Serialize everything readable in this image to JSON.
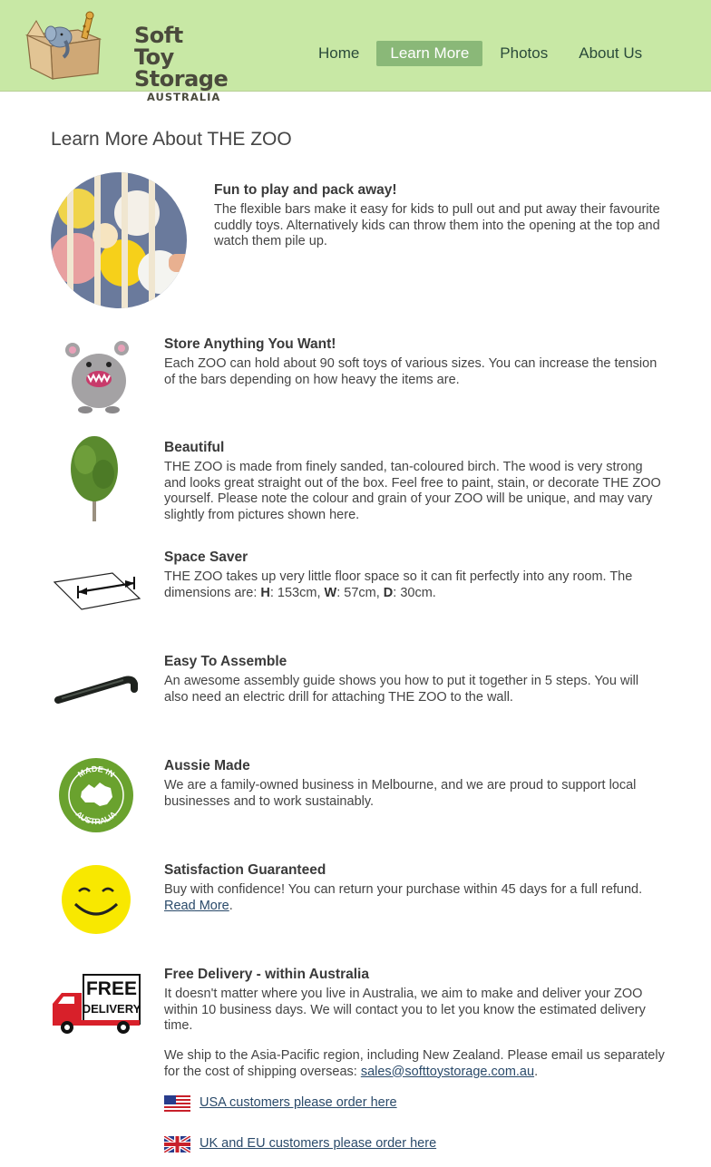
{
  "brand": {
    "line1": "Soft Toy",
    "line2": "Storage",
    "line3": "AUSTRALIA"
  },
  "nav": [
    {
      "label": "Home",
      "active": false
    },
    {
      "label": "Learn More",
      "active": true
    },
    {
      "label": "Photos",
      "active": false
    },
    {
      "label": "About Us",
      "active": false
    }
  ],
  "page": {
    "title": "Learn More About THE ZOO"
  },
  "features": [
    {
      "title": "Fun to play and pack away!",
      "body": "The flexible bars make it easy for kids to pull out and put away their favourite cuddly toys. Alternatively kids can throw them into the opening at the top and watch them pile up."
    },
    {
      "title": "Store Anything You Want!",
      "body": "Each ZOO can hold about 90 soft toys of various sizes. You can increase the tension of the bars depending on how heavy the items are."
    },
    {
      "title": "Beautiful",
      "body": "THE ZOO is made from finely sanded, tan-coloured birch. The wood is very strong and looks great straight out of the box. Feel free to paint, stain, or decorate THE ZOO yourself. Please note the colour and grain of your ZOO will be unique, and may vary slightly from pictures shown here."
    },
    {
      "title": "Space Saver",
      "body_prefix": "THE ZOO takes up very little floor space so it can fit perfectly into any room. The dimensions are: ",
      "h_label": "H",
      "h_value": ": 153cm, ",
      "w_label": "W",
      "w_value": ": 57cm, ",
      "d_label": "D",
      "d_value": ": 30cm."
    },
    {
      "title": "Easy To Assemble",
      "body": "An awesome assembly guide shows you how to put it together in 5 steps. You will also need an electric drill for attaching THE ZOO to the wall."
    },
    {
      "title": "Aussie Made",
      "body": "We are a family-owned business in Melbourne, and we are proud to support local businesses and to work sustainably.",
      "badge_top": "MADE IN",
      "badge_bottom": "AUSTRALIA"
    },
    {
      "title": "Satisfaction Guaranteed",
      "body": "Buy with confidence! You can return your purchase within 45 days for a full refund. ",
      "link": "Read More",
      "after_link": "."
    },
    {
      "title": "Free Delivery - within Australia",
      "body": "It doesn't matter where you live in Australia, we aim to make and deliver your ZOO within 10 business days. We will contact you to let you know the estimated delivery time.",
      "body2": "We ship to the Asia-Pacific region, including New Zealand. Please email us separately for the cost of shipping overseas: ",
      "email": "sales@softtoystorage.com.au",
      "after_email": ".",
      "truck_line1": "FREE",
      "truck_line2": "DELIVERY"
    }
  ],
  "orders": {
    "usa": "USA customers please order here",
    "uk": "UK and EU customers please order here"
  },
  "colors": {
    "header_bg": "#c8e8a5",
    "nav_active_bg": "#8ab878",
    "link": "#2a4a6a",
    "smiley": "#f8e800",
    "aussie_green": "#6aa22e"
  }
}
